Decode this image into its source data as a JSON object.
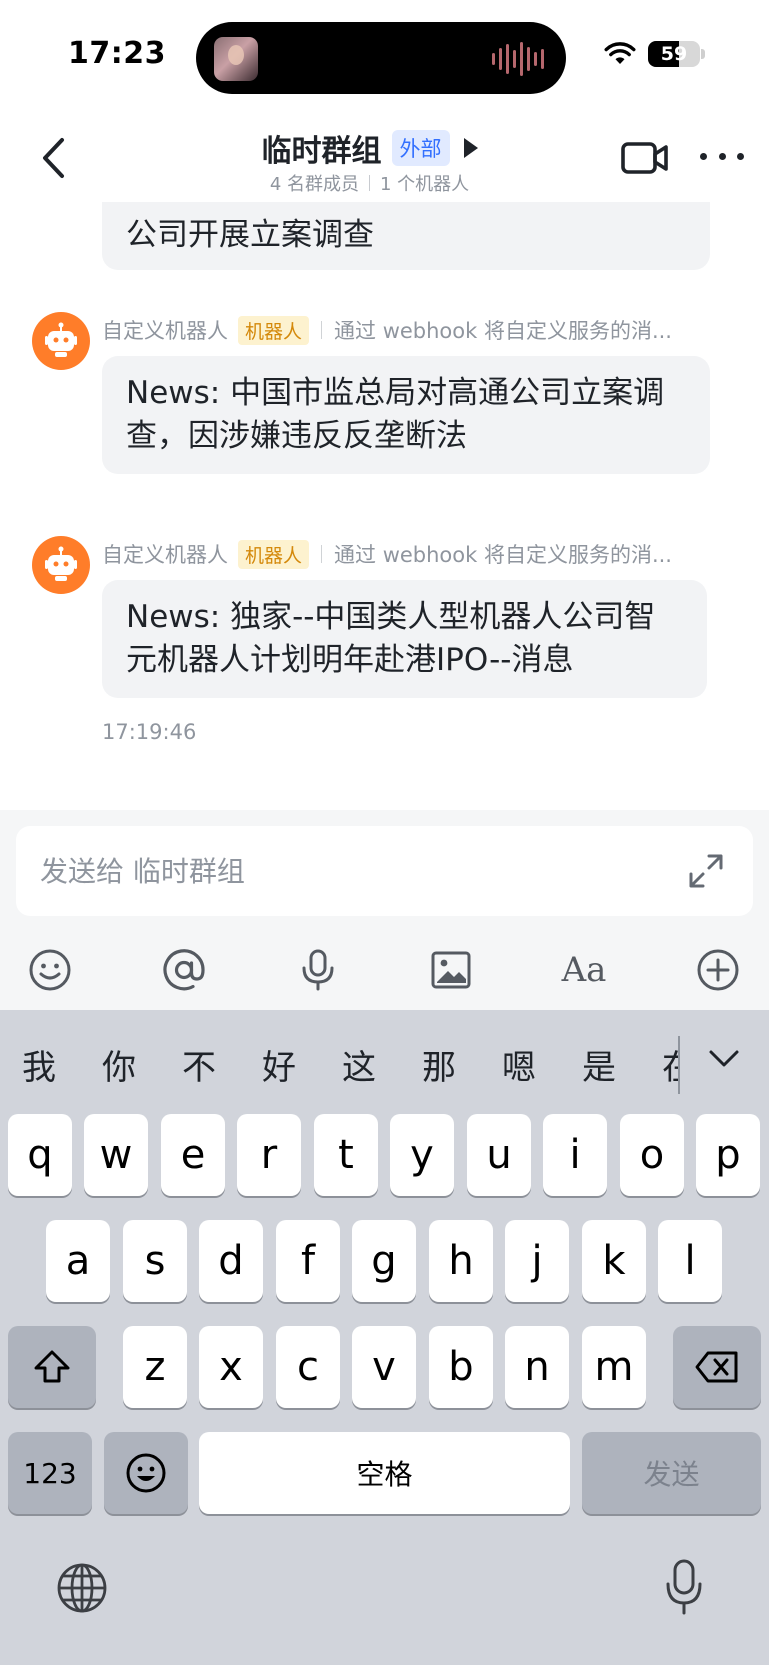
{
  "status_bar": {
    "time": "17:23",
    "battery": "59",
    "battery_level": 0.59,
    "icons": [
      "now-playing-icon",
      "audio-wave-icon",
      "wifi-icon",
      "battery-icon"
    ]
  },
  "header": {
    "title": "临时群组",
    "external_badge": "外部",
    "members": "4 名群成员",
    "bots": "1 个机器人",
    "icons": [
      "back-icon",
      "play-icon",
      "video-call-icon",
      "more-icon"
    ]
  },
  "messages": {
    "partial_text": "公司开展立案调查",
    "items": [
      {
        "sender": "自定义机器人",
        "badge": "机器人",
        "description": "通过 webhook 将自定义服务的消...",
        "text": "News: 中国市监总局对高通公司立案调查，因涉嫌违反反垄断法"
      },
      {
        "sender": "自定义机器人",
        "badge": "机器人",
        "description": "通过 webhook 将自定义服务的消...",
        "text": "News: 独家--中国类人型机器人公司智元机器人计划明年赴港IPO--消息",
        "time": "17:19:46"
      }
    ]
  },
  "composer": {
    "placeholder": "发送给 临时群组",
    "font_tool": "Aa",
    "icons": [
      "expand-icon",
      "emoji-icon",
      "mention-icon",
      "voice-icon",
      "image-icon",
      "font-format-icon",
      "add-icon"
    ]
  },
  "keyboard": {
    "candidates": [
      "我",
      "你",
      "不",
      "好",
      "这",
      "那",
      "嗯",
      "是",
      "在"
    ],
    "row1": [
      "q",
      "w",
      "e",
      "r",
      "t",
      "y",
      "u",
      "i",
      "o",
      "p"
    ],
    "row2": [
      "a",
      "s",
      "d",
      "f",
      "g",
      "h",
      "j",
      "k",
      "l"
    ],
    "row3": [
      "z",
      "x",
      "c",
      "v",
      "b",
      "n",
      "m"
    ],
    "numbers_key": "123",
    "space_key": "空格",
    "send_key": "发送",
    "icons": [
      "shift-icon",
      "delete-icon",
      "emoji-key-icon",
      "globe-icon",
      "dictation-mic-icon",
      "collapse-candidates-icon"
    ]
  },
  "colors": {
    "accent_blue": "#3370ff",
    "bot_avatar": "#ff7d29",
    "bot_badge_text": "#d4890b",
    "bubble_bg": "#f2f3f5",
    "keyboard_bg": "#d1d4db"
  }
}
